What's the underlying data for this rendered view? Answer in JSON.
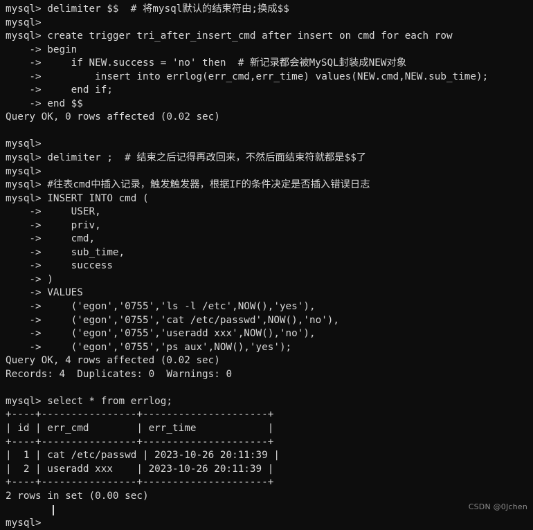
{
  "terminal": {
    "app": "mysql-client",
    "background_color": "#0d0d0d",
    "text_color": "#d8d8d8",
    "prompt": "mysql>",
    "continuation_prompt": "->",
    "cursor_visible": true,
    "lines": [
      "mysql> delimiter $$  # 将mysql默认的结束符由;换成$$",
      "mysql>",
      "mysql> create trigger tri_after_insert_cmd after insert on cmd for each row",
      "    -> begin",
      "    ->     if NEW.success = 'no' then  # 新记录都会被MySQL封装成NEW对象",
      "    ->         insert into errlog(err_cmd,err_time) values(NEW.cmd,NEW.sub_time);",
      "    ->     end if;",
      "    -> end $$",
      "Query OK, 0 rows affected (0.02 sec)",
      "",
      "mysql>",
      "mysql> delimiter ;  # 结束之后记得再改回来，不然后面结束符就都是$$了",
      "mysql>",
      "mysql> #往表cmd中插入记录，触发触发器，根据IF的条件决定是否插入错误日志",
      "mysql> INSERT INTO cmd (",
      "    ->     USER,",
      "    ->     priv,",
      "    ->     cmd,",
      "    ->     sub_time,",
      "    ->     success",
      "    -> )",
      "    -> VALUES",
      "    ->     ('egon','0755','ls -l /etc',NOW(),'yes'),",
      "    ->     ('egon','0755','cat /etc/passwd',NOW(),'no'),",
      "    ->     ('egon','0755','useradd xxx',NOW(),'no'),",
      "    ->     ('egon','0755','ps aux',NOW(),'yes');",
      "Query OK, 4 rows affected (0.02 sec)",
      "Records: 4  Duplicates: 0  Warnings: 0",
      "",
      "mysql> select * from errlog;",
      "+----+----------------+---------------------+",
      "| id | err_cmd        | err_time            |",
      "+----+----------------+---------------------+",
      "|  1 | cat /etc/passwd | 2023-10-26 20:11:39 |",
      "|  2 | useradd xxx    | 2023-10-26 20:11:39 |",
      "+----+----------------+---------------------+",
      "2 rows in set (0.00 sec)",
      "",
      "mysql> "
    ]
  },
  "commands": {
    "delimiter_set": "delimiter $$",
    "delimiter_set_comment": "# 将mysql默认的结束符由;换成$$",
    "delimiter_reset": "delimiter ;",
    "delimiter_reset_comment": "# 结束之后记得再改回来，不然后面结束符就都是$$了",
    "create_trigger": "create trigger tri_after_insert_cmd after insert on cmd for each row",
    "trigger_name": "tri_after_insert_cmd",
    "trigger_table": "cmd",
    "trigger_body": [
      "begin",
      "if NEW.success = 'no' then",
      "insert into errlog(err_cmd,err_time) values(NEW.cmd,NEW.sub_time);",
      "end if;",
      "end $$"
    ],
    "trigger_inline_comment": "# 新记录都会被MySQL封装成NEW对象",
    "insert_comment": "#往表cmd中插入记录，触发触发器，根据IF的条件决定是否插入错误日志",
    "insert_statement": "INSERT INTO cmd (",
    "insert_columns": [
      "USER",
      "priv",
      "cmd",
      "sub_time",
      "success"
    ],
    "insert_values": [
      "('egon','0755','ls -l /etc',NOW(),'yes'),",
      "('egon','0755','cat /etc/passwd',NOW(),'no'),",
      "('egon','0755','useradd xxx',NOW(),'no'),",
      "('egon','0755','ps aux',NOW(),'yes');"
    ],
    "select_statement": "select * from errlog;"
  },
  "results": {
    "trigger_result": "Query OK, 0 rows affected (0.02 sec)",
    "insert_result": "Query OK, 4 rows affected (0.02 sec)",
    "insert_summary": "Records: 4  Duplicates: 0  Warnings: 0",
    "select_summary": "2 rows in set (0.00 sec)"
  },
  "result_table": {
    "columns": [
      "id",
      "err_cmd",
      "err_time"
    ],
    "rows": [
      [
        "1",
        "cat /etc/passwd",
        "2023-10-26 20:11:39"
      ],
      [
        "2",
        "useradd xxx",
        "2023-10-26 20:11:39"
      ]
    ],
    "separator": "+----+----------------+---------------------+"
  },
  "watermark": {
    "text": "CSDN @0Jchen"
  }
}
